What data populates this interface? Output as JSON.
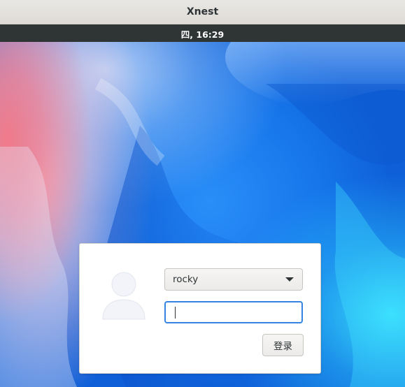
{
  "window": {
    "title": "Xnest"
  },
  "panel": {
    "clock": "四, 16:29"
  },
  "login": {
    "username": "rocky",
    "password_value": "",
    "login_button_label": "登录"
  },
  "colors": {
    "accent": "#3584e4",
    "panel_bg": "#2f3435",
    "titlebar_bg": "#e4e1dd"
  },
  "icons": {
    "avatar": "user-avatar-icon",
    "dropdown": "chevron-down-icon"
  }
}
